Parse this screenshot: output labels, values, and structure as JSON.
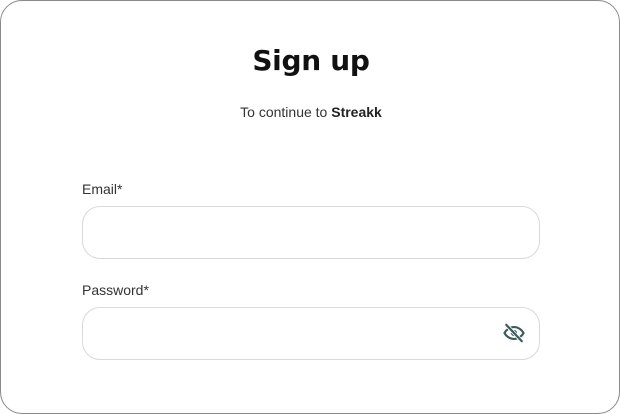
{
  "header": {
    "title": "Sign up",
    "subtitle_prefix": "To continue to ",
    "app_name": "Streakk"
  },
  "form": {
    "email": {
      "label": "Email*",
      "value": "",
      "placeholder": ""
    },
    "password": {
      "label": "Password*",
      "value": "",
      "placeholder": "",
      "toggle_icon": "eye-off-icon"
    }
  },
  "colors": {
    "border": "#8a8a8a",
    "input_border": "#d9d9d9",
    "icon": "#3d5a5a"
  }
}
